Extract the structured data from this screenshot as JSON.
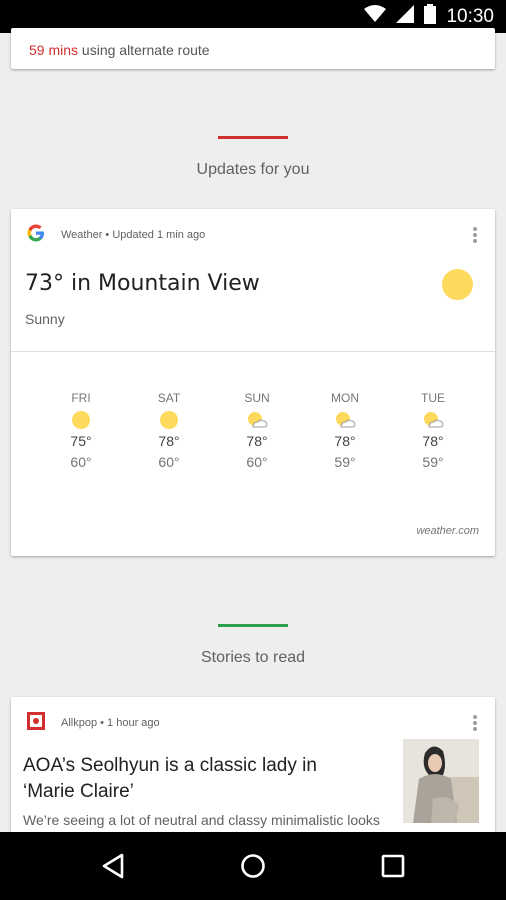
{
  "status_bar": {
    "time": "10:30"
  },
  "traffic": {
    "minutes": "59 mins",
    "rest": " using alternate route"
  },
  "sections": {
    "updates": {
      "title": "Updates for you",
      "color": "#d32f2f"
    },
    "stories": {
      "title": "Stories to read",
      "color": "#2e9e48"
    }
  },
  "weather": {
    "source": "Weather • Updated 1 min ago",
    "title": "73° in Mountain View",
    "condition": "Sunny",
    "attribution": "weather.com",
    "forecast": [
      {
        "day": "FRI",
        "icon": "sun-icon",
        "high": "75°",
        "low": "60°"
      },
      {
        "day": "SAT",
        "icon": "sun-icon",
        "high": "78°",
        "low": "60°"
      },
      {
        "day": "SUN",
        "icon": "partly-cloudy-icon",
        "high": "78°",
        "low": "60°"
      },
      {
        "day": "MON",
        "icon": "partly-cloudy-icon",
        "high": "78°",
        "low": "59°"
      },
      {
        "day": "TUE",
        "icon": "partly-cloudy-icon",
        "high": "78°",
        "low": "59°"
      }
    ]
  },
  "story": {
    "source": "Allkpop • 1 hour ago",
    "title": "AOA’s Seolhyun is a classic lady in ‘Marie Claire’",
    "snippet": "We’re seeing a lot of neutral and classy minimalistic looks"
  }
}
